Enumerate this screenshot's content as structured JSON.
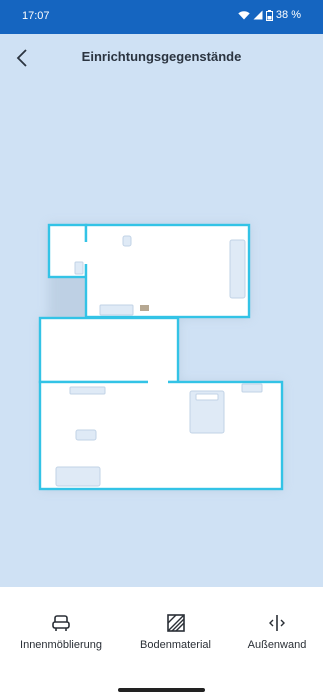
{
  "status_bar": {
    "time": "17:07",
    "battery": "38 %",
    "icons": [
      "wifi-icon",
      "signal-icon",
      "battery-icon"
    ]
  },
  "header": {
    "title": "Einrichtungsgegenstände",
    "back_icon": "chevron-left-icon"
  },
  "colors": {
    "status_bar": "#1565c0",
    "background": "#cfe1f4",
    "wall": "#33c3e6",
    "room_fill": "#ffffff",
    "furniture": "#dfeaf6"
  },
  "bottom_nav": {
    "items": [
      {
        "label": "Innenmöblierung",
        "icon": "armchair-icon"
      },
      {
        "label": "Bodenmaterial",
        "icon": "floor-tiles-icon"
      },
      {
        "label": "Außenwand",
        "icon": "exterior-wall-icon"
      }
    ]
  }
}
